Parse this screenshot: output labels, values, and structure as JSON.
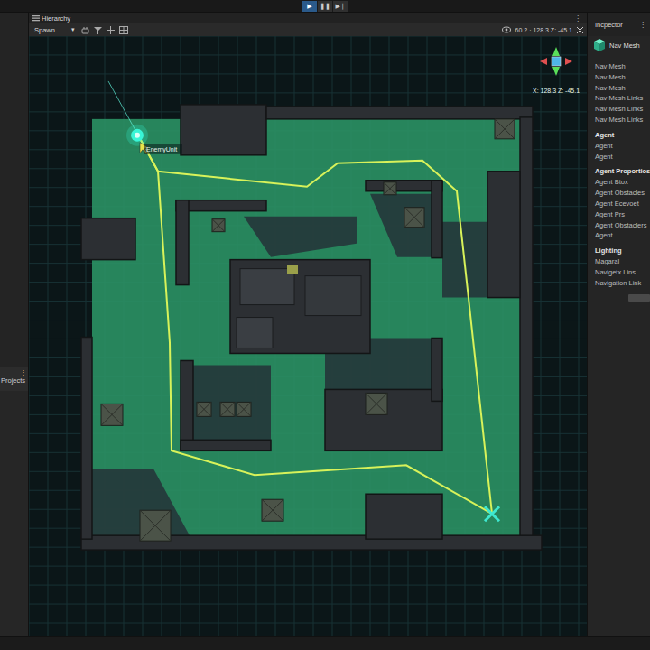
{
  "toolbar": {
    "controls": [
      {
        "icon": "▶",
        "selected": true
      },
      {
        "icon": "❚❚",
        "selected": false
      },
      {
        "icon": "▶❘",
        "selected": false
      }
    ]
  },
  "hierarchy": {
    "tab": "Hierarchy",
    "menu_icon": "⋮",
    "search": "Spawn",
    "dropdown": "▾",
    "coordinates": "60.2 · 128.3 Z: -45.1"
  },
  "projects": {
    "tab": "Projects",
    "menu_icon": "⋮"
  },
  "scene": {
    "agent_label": "EnemyUnit",
    "gizmo_readout": "X: 128.3 Z: -45.1"
  },
  "inspector": {
    "title": "Incpector",
    "menu_icon": "⋮",
    "component": "Nav Mesh",
    "items": [
      "Nav Mesh",
      "Nav Mesh",
      "Nav Mesh",
      "Nav Mesh Links",
      "Nav Mesh Links",
      "Nav Mesh Links"
    ],
    "sections": [
      {
        "heading": "Agent",
        "items": [
          "Agent",
          "Agent"
        ]
      },
      {
        "heading": "Agent Proportios",
        "items": [
          "Agent Btox",
          "Agent Obstacles",
          "Agent Ecevoet",
          "Agent Prs",
          "Agent Obstaclers",
          "Agent"
        ]
      },
      {
        "heading": "Lighting",
        "items": [
          "Magaral",
          "Navigetx Lins",
          "Navigation Link"
        ]
      }
    ]
  }
}
